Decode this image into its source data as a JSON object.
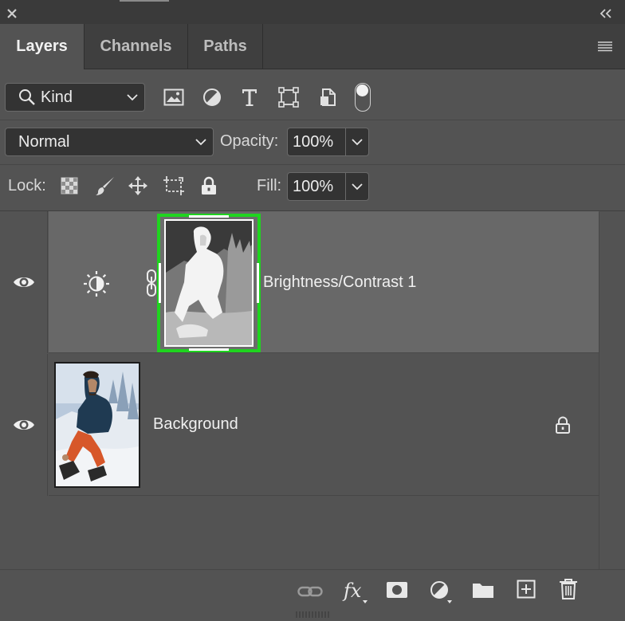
{
  "tabs": [
    {
      "label": "Layers",
      "active": true
    },
    {
      "label": "Channels",
      "active": false
    },
    {
      "label": "Paths",
      "active": false
    }
  ],
  "filter": {
    "kind_label": "Kind"
  },
  "blend": {
    "mode": "Normal",
    "opacity_label": "Opacity:",
    "opacity_value": "100%"
  },
  "lock": {
    "label": "Lock:",
    "fill_label": "Fill:",
    "fill_value": "100%"
  },
  "layers": [
    {
      "name": "Brightness/Contrast 1",
      "type": "adjustment",
      "visible": true,
      "selected": true,
      "mask_outline_color": "#1fd41f"
    },
    {
      "name": "Background",
      "type": "image",
      "visible": true,
      "locked": true
    }
  ],
  "colors": {
    "panel": "#535353",
    "selected_row": "#676767",
    "field": "#333333",
    "highlight": "#1fd41f"
  }
}
